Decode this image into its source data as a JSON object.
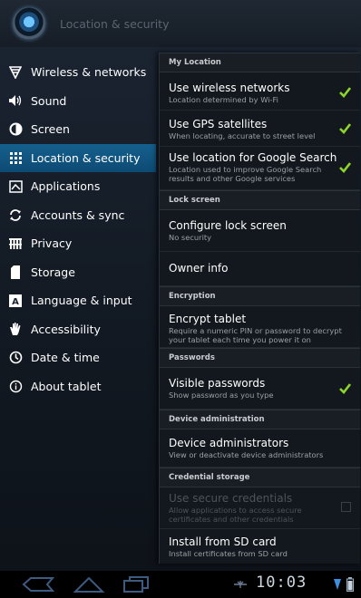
{
  "header": {
    "title": "Location & security"
  },
  "sidebar": {
    "items": [
      {
        "label": "Wireless & networks",
        "icon": "wifi-icon"
      },
      {
        "label": "Sound",
        "icon": "speaker-icon"
      },
      {
        "label": "Screen",
        "icon": "brightness-icon"
      },
      {
        "label": "Location & security",
        "icon": "location-grid-icon",
        "selected": true
      },
      {
        "label": "Applications",
        "icon": "applications-icon"
      },
      {
        "label": "Accounts & sync",
        "icon": "sync-icon"
      },
      {
        "label": "Privacy",
        "icon": "privacy-icon"
      },
      {
        "label": "Storage",
        "icon": "storage-icon"
      },
      {
        "label": "Language & input",
        "icon": "language-icon"
      },
      {
        "label": "Accessibility",
        "icon": "hand-icon"
      },
      {
        "label": "Date & time",
        "icon": "clock-icon"
      },
      {
        "label": "About tablet",
        "icon": "info-icon"
      }
    ]
  },
  "panel": {
    "my_location": {
      "header": "My Location",
      "wireless": {
        "title": "Use wireless networks",
        "summary": "Location determined by Wi-Fi",
        "checked": true
      },
      "gps": {
        "title": "Use GPS satellites",
        "summary": "When locating, accurate to street level",
        "checked": true
      },
      "google": {
        "title": "Use location for Google Search",
        "summary": "Location used to improve Google Search results and other Google services",
        "checked": true
      }
    },
    "lock_screen": {
      "header": "Lock screen",
      "configure": {
        "title": "Configure lock screen",
        "summary": "No security"
      },
      "owner": {
        "title": "Owner info"
      }
    },
    "encryption": {
      "header": "Encryption",
      "encrypt": {
        "title": "Encrypt tablet",
        "summary": "Require a numeric PIN or password to decrypt your tablet each time you power it on"
      }
    },
    "passwords": {
      "header": "Passwords",
      "visible": {
        "title": "Visible passwords",
        "summary": "Show password as you type",
        "checked": true
      }
    },
    "device_admin": {
      "header": "Device administration",
      "admins": {
        "title": "Device administrators",
        "summary": "View or deactivate device administrators"
      }
    },
    "credential": {
      "header": "Credential storage",
      "secure": {
        "title": "Use secure credentials",
        "summary": "Allow applications to access secure certificates and other credentials",
        "checked": false,
        "disabled": true
      },
      "install": {
        "title": "Install from SD card",
        "summary": "Install certificates from SD card"
      }
    }
  },
  "navbar": {
    "clock": "10:03"
  },
  "colors": {
    "selected_bg": "#0d4b74",
    "check_green": "#8fd42a"
  }
}
